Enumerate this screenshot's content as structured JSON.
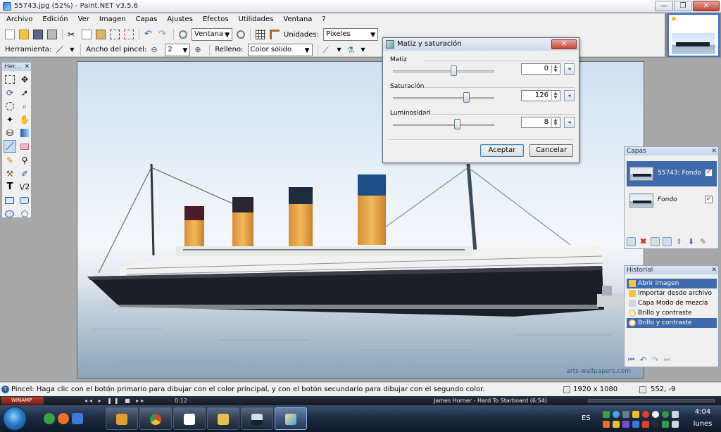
{
  "window": {
    "title": "55743.jpg (52%) - Paint.NET v3.5.6",
    "minimize": "—",
    "maximize": "❐",
    "close": "✕"
  },
  "menu": [
    "Archivo",
    "Edición",
    "Ver",
    "Imagen",
    "Capas",
    "Ajustes",
    "Efectos",
    "Utilidades",
    "Ventana",
    "?"
  ],
  "toolbar1": {
    "zoom_mode": "Ventana",
    "units_label": "Unidades:",
    "units_value": "Píxeles"
  },
  "toolbar2": {
    "tool_label": "Herramienta:",
    "brush_width_label": "Ancho del pincel:",
    "brush_width_value": "2",
    "fill_label": "Relleno:",
    "fill_value": "Color sólido"
  },
  "tools_panel": {
    "title": "Her...",
    "close": "✕"
  },
  "dialog": {
    "title": "Matiz y saturación",
    "close": "✕",
    "rows": [
      {
        "label": "Matiz",
        "value": "0",
        "slider_fraction": 0.6
      },
      {
        "label": "Saturación",
        "value": "126",
        "slider_fraction": 0.72
      },
      {
        "label": "Luminosidad",
        "value": "8",
        "slider_fraction": 0.63
      }
    ],
    "ok": "Aceptar",
    "cancel": "Cancelar"
  },
  "layers_panel": {
    "title": "Capas",
    "close": "✕",
    "items": [
      {
        "name": "55743: Fondo",
        "checked": "✓"
      },
      {
        "name": "Fondo",
        "checked": "✓"
      }
    ]
  },
  "history_panel": {
    "title": "Historial",
    "close": "✕",
    "items": [
      "Abrir imagen",
      "Importar desde archivo",
      "Capa Modo de mezcla",
      "Brillo y contraste",
      "Brillo y contraste"
    ]
  },
  "canvas": {
    "watermark": "arts-wallpapers.com"
  },
  "status": {
    "text": "Pincel: Haga clic con el botón primario para dibujar con el color principal, y con el botón secundario para dibujar con el segundo color.",
    "image_size": "1920 x 1080",
    "cursor_pos": "552, -9"
  },
  "winamp": {
    "logo": "WINAMP",
    "controls": "◂◂ ▸ ❚❚ ■ ▸▸",
    "time": "0:12",
    "track": "James Horner - Hard To Starboard (6:54)"
  },
  "taskbar": {
    "language": "ES",
    "time": "4:04",
    "day": "lunes"
  },
  "colors": {
    "selection": "#3e6aab",
    "accent": "#3b6fc9"
  }
}
